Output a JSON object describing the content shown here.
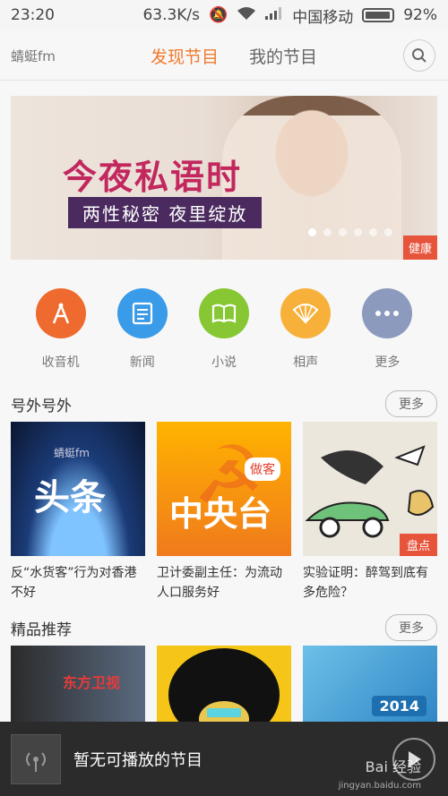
{
  "status": {
    "time": "23:20",
    "speed": "63.3K/s",
    "carrier": "中国移动",
    "battery": "92%"
  },
  "header": {
    "logo": "蜻蜓fm",
    "tabs": [
      {
        "label": "发现节目",
        "active": true
      },
      {
        "label": "我的节目",
        "active": false
      }
    ]
  },
  "banner": {
    "title": "今夜私语时",
    "subtitle": "两性秘密 夜里绽放",
    "tag": "健康",
    "dots_total": 6,
    "active_dot": 1
  },
  "categories": [
    {
      "label": "收音机",
      "color": "#ef6a2e",
      "icon": "radio-icon"
    },
    {
      "label": "新闻",
      "color": "#3a9be8",
      "icon": "news-icon"
    },
    {
      "label": "小说",
      "color": "#86c733",
      "icon": "book-icon"
    },
    {
      "label": "相声",
      "color": "#f7b13a",
      "icon": "fan-icon"
    },
    {
      "label": "更多",
      "color": "#8c9bbd",
      "icon": "more-icon"
    }
  ],
  "sections": {
    "haowai": {
      "title": "号外号外",
      "more": "更多",
      "items": [
        {
          "title": "反“水货客”行为对香港不好",
          "thumb_text": "头条",
          "logo": "蜻蜓fm"
        },
        {
          "title": "卫计委副主任：为流动人口服务好",
          "thumb_text": "中央台",
          "badge_text": "做客"
        },
        {
          "title": "实验证明：醉驾到底有多危险？",
          "badge": "盘点"
        }
      ]
    },
    "jingpin": {
      "title": "精品推荐",
      "more": "更多",
      "items": [
        {
          "thumb_text": "东方卫视"
        },
        {
          "thumb_text": ""
        },
        {
          "thumb_text": "2014"
        }
      ]
    }
  },
  "player": {
    "text": "暂无可播放的节目"
  },
  "watermark": {
    "brand": "Bai 经验",
    "url": "jingyan.baidu.com"
  }
}
